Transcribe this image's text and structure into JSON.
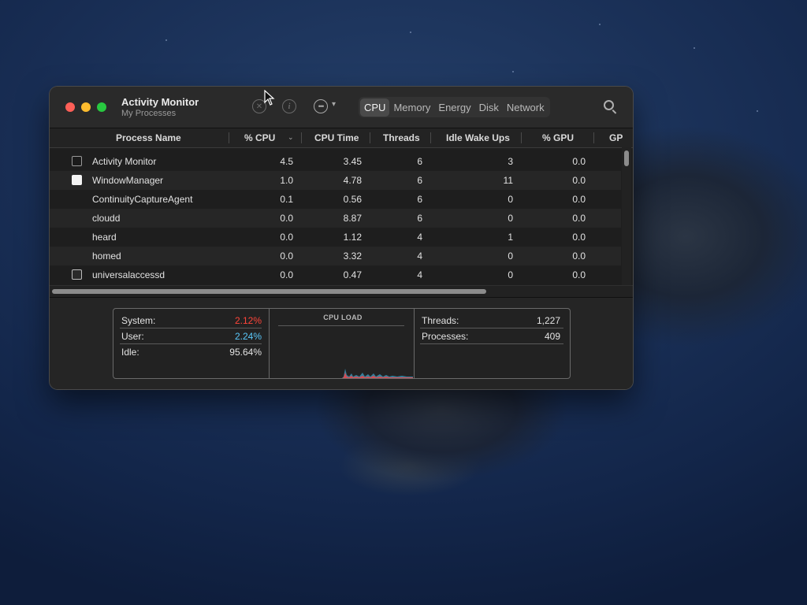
{
  "app": {
    "title": "Activity Monitor",
    "subtitle": "My Processes"
  },
  "toolbar": {
    "stop_icon": "x-circle-icon",
    "info_icon": "info-icon",
    "more_icon": "ellipsis-icon",
    "tabs": [
      {
        "label": "CPU",
        "active": true
      },
      {
        "label": "Memory",
        "active": false
      },
      {
        "label": "Energy",
        "active": false
      },
      {
        "label": "Disk",
        "active": false
      },
      {
        "label": "Network",
        "active": false
      }
    ],
    "search_icon": "magnifier-icon"
  },
  "table": {
    "columns": [
      "Process Name",
      "% CPU",
      "CPU Time",
      "Threads",
      "Idle Wake Ups",
      "% GPU",
      "GP"
    ],
    "sorted_column": "% CPU",
    "rows": [
      {
        "icon": "activity-monitor-icon",
        "name": "Activity Monitor",
        "cpu": "4.5",
        "cpu_time": "3.45",
        "threads": "6",
        "idle_wake_ups": "3",
        "gpu": "0.0"
      },
      {
        "icon": "window-manager-icon",
        "name": "WindowManager",
        "cpu": "1.0",
        "cpu_time": "4.78",
        "threads": "6",
        "idle_wake_ups": "11",
        "gpu": "0.0"
      },
      {
        "icon": "",
        "name": "ContinuityCaptureAgent",
        "cpu": "0.1",
        "cpu_time": "0.56",
        "threads": "6",
        "idle_wake_ups": "0",
        "gpu": "0.0"
      },
      {
        "icon": "",
        "name": "cloudd",
        "cpu": "0.0",
        "cpu_time": "8.87",
        "threads": "6",
        "idle_wake_ups": "0",
        "gpu": "0.0"
      },
      {
        "icon": "",
        "name": "heard",
        "cpu": "0.0",
        "cpu_time": "1.12",
        "threads": "4",
        "idle_wake_ups": "1",
        "gpu": "0.0"
      },
      {
        "icon": "",
        "name": "homed",
        "cpu": "0.0",
        "cpu_time": "3.32",
        "threads": "4",
        "idle_wake_ups": "0",
        "gpu": "0.0"
      },
      {
        "icon": "universal-access-icon",
        "name": "universalaccessd",
        "cpu": "0.0",
        "cpu_time": "0.47",
        "threads": "4",
        "idle_wake_ups": "0",
        "gpu": "0.0"
      }
    ]
  },
  "summary": {
    "system_label": "System:",
    "system_value": "2.12%",
    "user_label": "User:",
    "user_value": "2.24%",
    "idle_label": "Idle:",
    "idle_value": "95.64%",
    "cpu_load_title": "CPU LOAD",
    "threads_label": "Threads:",
    "threads_value": "1,227",
    "processes_label": "Processes:",
    "processes_value": "409"
  },
  "colors": {
    "system": "#ff453a",
    "user": "#5ac8fa",
    "accent_close": "#fe5f57",
    "accent_min": "#febc2e",
    "accent_max": "#28c840"
  }
}
